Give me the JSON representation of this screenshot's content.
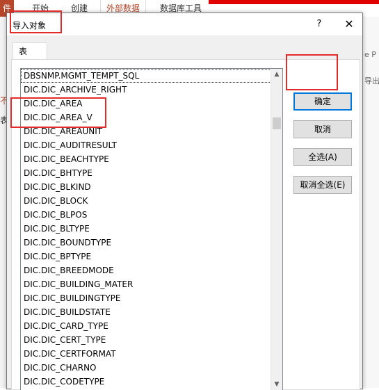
{
  "ribbon": {
    "file": "件",
    "tabs": [
      "开始",
      "创建",
      "外部数据",
      "数据库工具"
    ],
    "right_texts": [
      "e P",
      "导出"
    ]
  },
  "left_strip": [
    "不",
    "表"
  ],
  "dialog": {
    "title": "导入对象",
    "help": "?",
    "close": "✕",
    "tab": "表",
    "items": [
      "DBSNMP.MGMT_TEMPT_SQL",
      "DIC.DIC_ARCHIVE_RIGHT",
      "DIC.DIC_AREA",
      "DIC.DIC_AREA_V",
      "DIC.DIC_AREAUNIT",
      "DIC.DIC_AUDITRESULT",
      "DIC.DIC_BEACHTYPE",
      "DIC.DIC_BHTYPE",
      "DIC.DIC_BLKIND",
      "DIC.DIC_BLOCK",
      "DIC.DIC_BLPOS",
      "DIC.DIC_BLTYPE",
      "DIC.DIC_BOUNDTYPE",
      "DIC.DIC_BPTYPE",
      "DIC.DIC_BREEDMODE",
      "DIC.DIC_BUILDING_MATER",
      "DIC.DIC_BUILDINGTYPE",
      "DIC.DIC_BUILDSTATE",
      "DIC.DIC_CARD_TYPE",
      "DIC.DIC_CERT_TYPE",
      "DIC.DIC_CERTFORMAT",
      "DIC.DIC_CHARNO",
      "DIC.DIC_CODETYPE"
    ],
    "buttons": {
      "ok": "确定",
      "cancel": "取消",
      "select_all": "全选(A)",
      "deselect_all": "取消全选(E)"
    }
  },
  "colors": {
    "highlight": "#e32b2b",
    "accent": "#b7472a",
    "default_button_border": "#0078d7"
  }
}
